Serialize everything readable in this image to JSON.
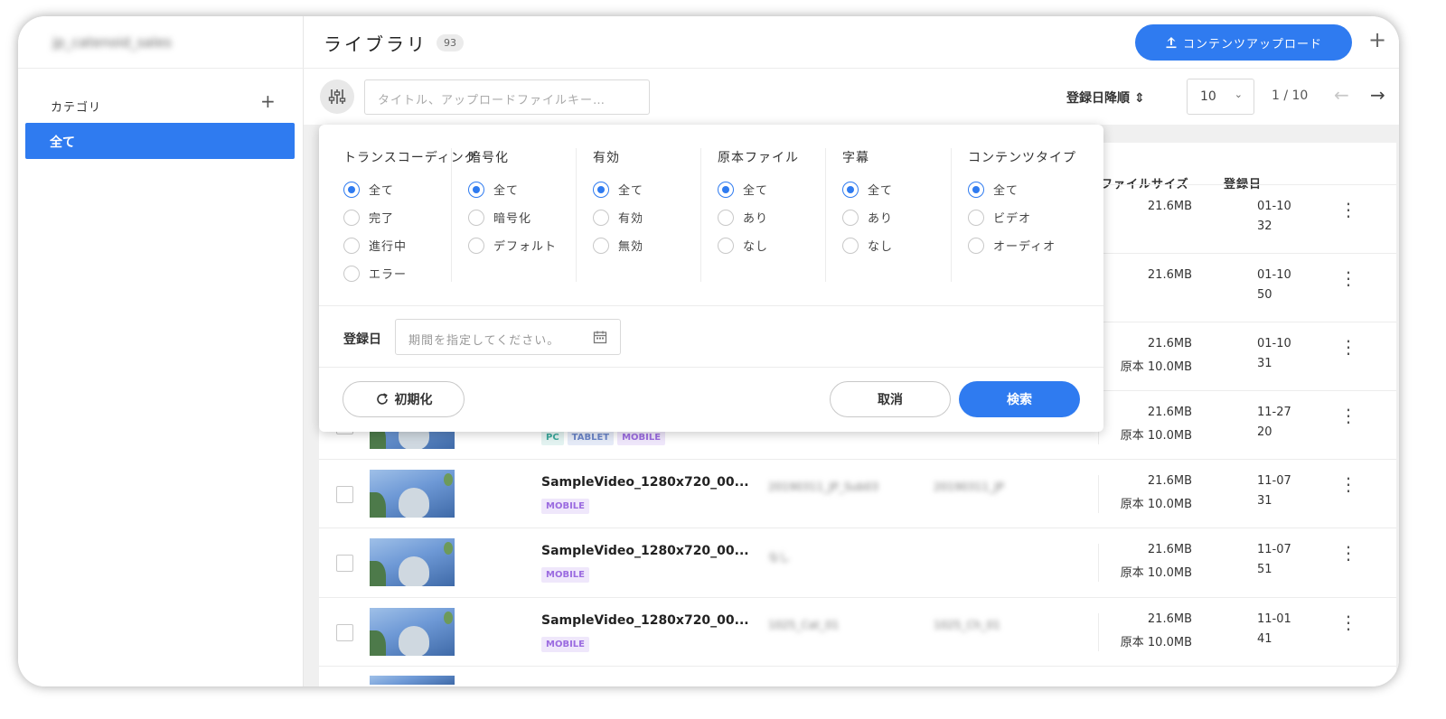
{
  "sidebar": {
    "account_name": "jp_catenoid_sales",
    "category_heading": "カテゴリ",
    "category_add": "+",
    "items": [
      {
        "label": "全て"
      }
    ]
  },
  "header": {
    "title": "ライブラリ",
    "count": "93",
    "upload_label": "コンテンツアップロード",
    "add": "+"
  },
  "toolbar": {
    "search_placeholder": "タイトル、アップロードファイルキー…",
    "sort_label": "登録日降順",
    "page_size": "10",
    "page_info": "1 / 10"
  },
  "table": {
    "columns": {
      "file_size": "ファイルサイズ",
      "date": "登録日"
    },
    "rows": [
      {
        "title": "",
        "tags": [],
        "meta1": "",
        "meta2": "",
        "size": "21.6MB",
        "original_size": "",
        "date": "01-10",
        "time": "32"
      },
      {
        "title": "",
        "tags": [],
        "meta1": "",
        "meta2": "",
        "size": "21.6MB",
        "original_size": "",
        "date": "01-10",
        "time": "50"
      },
      {
        "title": "",
        "tags": [],
        "meta1": "",
        "meta2": "",
        "size": "21.6MB",
        "original_size": "原本 10.0MB",
        "date": "01-10",
        "time": "31"
      },
      {
        "title": "",
        "tags": [
          "PC",
          "TABLET",
          "MOBILE"
        ],
        "meta1": "",
        "meta2": "",
        "size": "21.6MB",
        "original_size": "原本 10.0MB",
        "date": "11-27",
        "time": "20"
      },
      {
        "title": "SampleVideo_1280x720_00...",
        "tags": [
          "MOBILE"
        ],
        "meta1": "20190311_JP_Sub03",
        "meta2": "20190311_JP",
        "size": "21.6MB",
        "original_size": "原本 10.0MB",
        "date": "11-07",
        "time": "31"
      },
      {
        "title": "SampleVideo_1280x720_00...",
        "tags": [
          "MOBILE"
        ],
        "meta1": "なし",
        "meta2": "",
        "size": "21.6MB",
        "original_size": "原本 10.0MB",
        "date": "11-07",
        "time": "51"
      },
      {
        "title": "SampleVideo_1280x720_00...",
        "tags": [
          "MOBILE"
        ],
        "meta1": "1025_Cat_01",
        "meta2": "1025_Ch_01",
        "size": "21.6MB",
        "original_size": "原本 10.0MB",
        "date": "11-01",
        "time": "41"
      }
    ]
  },
  "filter": {
    "groups": [
      {
        "title": "トランスコーディング",
        "options": [
          "全て",
          "完了",
          "進行中",
          "エラー"
        ],
        "selected": 0
      },
      {
        "title": "暗号化",
        "options": [
          "全て",
          "暗号化",
          "デフォルト"
        ],
        "selected": 0
      },
      {
        "title": "有効",
        "options": [
          "全て",
          "有効",
          "無効"
        ],
        "selected": 0
      },
      {
        "title": "原本ファイル",
        "options": [
          "全て",
          "あり",
          "なし"
        ],
        "selected": 0
      },
      {
        "title": "字幕",
        "options": [
          "全て",
          "あり",
          "なし"
        ],
        "selected": 0
      },
      {
        "title": "コンテンツタイプ",
        "options": [
          "全て",
          "ビデオ",
          "オーディオ"
        ],
        "selected": 0
      }
    ],
    "date_label": "登録日",
    "date_placeholder": "期間を指定してください。",
    "reset_label": "初期化",
    "cancel_label": "取消",
    "search_label": "検索"
  },
  "colors": {
    "accent": "#2f7bf0"
  }
}
